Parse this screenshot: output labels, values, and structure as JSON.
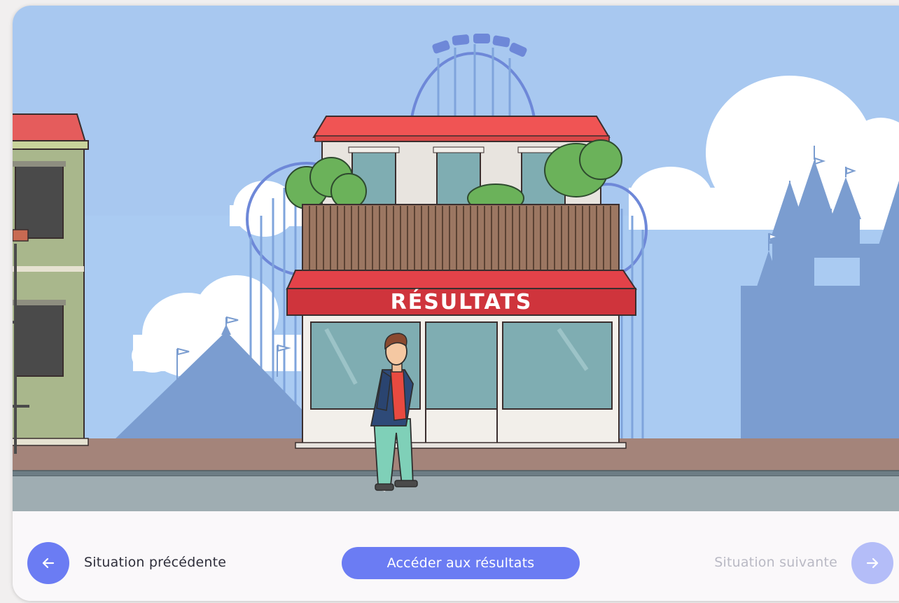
{
  "scene": {
    "sign_text": "RÉSULTATS",
    "alt": ""
  },
  "navigation": {
    "previous_label": "Situation précédente",
    "results_label": "Accéder aux résultats",
    "next_label": "Situation suivante",
    "previous_icon": "arrow-left-icon",
    "next_icon": "arrow-right-icon"
  },
  "colors": {
    "accent": "#6b7cf3",
    "accent_disabled": "#b4bdf8",
    "awning": "#d93a42",
    "roof": "#f05454",
    "sky": "#a8c8f0"
  }
}
